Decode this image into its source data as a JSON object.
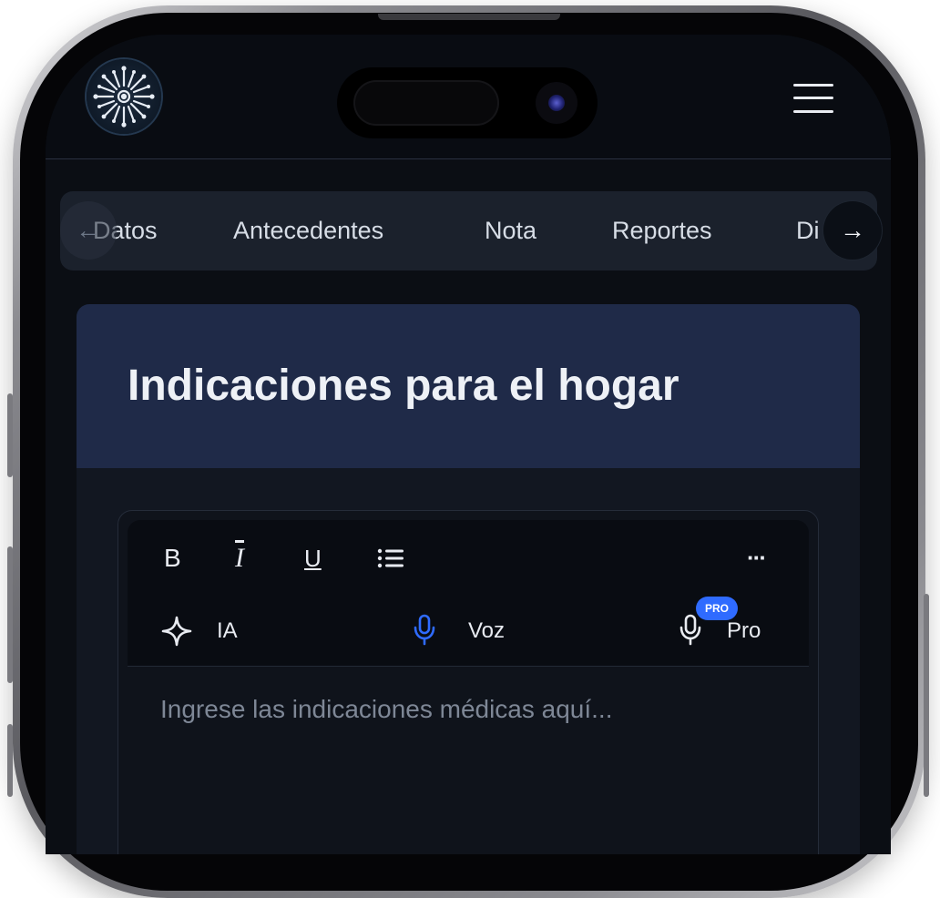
{
  "tabs": {
    "items": [
      "Datos",
      "Antecedentes",
      "Nota",
      "Reportes",
      "Di"
    ],
    "prev_icon": "←",
    "next_icon": "→"
  },
  "card": {
    "title": "Indicaciones para el hogar"
  },
  "editor": {
    "toolbar": {
      "bold": "B",
      "italic": "I",
      "underline": "U",
      "more": "···",
      "ai_label": "IA",
      "voice_label": "Voz",
      "pro_label": "Pro",
      "pro_badge": "PRO"
    },
    "placeholder": "Ingrese las indicaciones médicas aquí..."
  },
  "colors": {
    "accent": "#2f6bff",
    "card_header": "#1f2a48",
    "background": "#0b0e14"
  },
  "icons": [
    "logo-icon",
    "menu-icon",
    "arrow-left-icon",
    "arrow-right-icon",
    "list-icon",
    "sparkle-icon",
    "microphone-icon"
  ]
}
